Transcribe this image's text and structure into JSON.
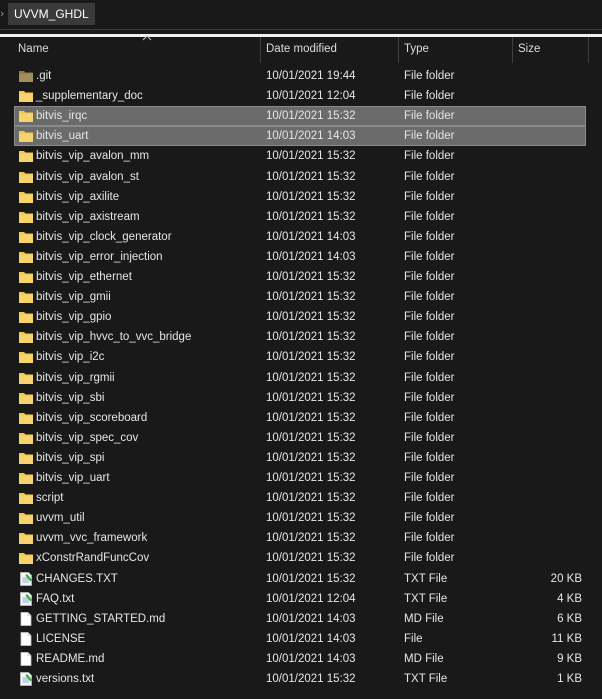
{
  "breadcrumb": {
    "items": [
      "UVVM_GHDL"
    ]
  },
  "columns": {
    "name": "Name",
    "date": "Date modified",
    "type": "Type",
    "size": "Size"
  },
  "files": [
    {
      "name": ".git",
      "date": "10/01/2021 19:44",
      "type": "File folder",
      "size": "",
      "icon": "folder-hidden-icon",
      "selected": false
    },
    {
      "name": "_supplementary_doc",
      "date": "10/01/2021 12:04",
      "type": "File folder",
      "size": "",
      "icon": "folder-icon",
      "selected": false
    },
    {
      "name": "bitvis_irqc",
      "date": "10/01/2021 15:32",
      "type": "File folder",
      "size": "",
      "icon": "folder-icon",
      "selected": true
    },
    {
      "name": "bitvis_uart",
      "date": "10/01/2021 14:03",
      "type": "File folder",
      "size": "",
      "icon": "folder-icon",
      "selected": true
    },
    {
      "name": "bitvis_vip_avalon_mm",
      "date": "10/01/2021 15:32",
      "type": "File folder",
      "size": "",
      "icon": "folder-icon",
      "selected": false
    },
    {
      "name": "bitvis_vip_avalon_st",
      "date": "10/01/2021 15:32",
      "type": "File folder",
      "size": "",
      "icon": "folder-icon",
      "selected": false
    },
    {
      "name": "bitvis_vip_axilite",
      "date": "10/01/2021 15:32",
      "type": "File folder",
      "size": "",
      "icon": "folder-icon",
      "selected": false
    },
    {
      "name": "bitvis_vip_axistream",
      "date": "10/01/2021 15:32",
      "type": "File folder",
      "size": "",
      "icon": "folder-icon",
      "selected": false
    },
    {
      "name": "bitvis_vip_clock_generator",
      "date": "10/01/2021 14:03",
      "type": "File folder",
      "size": "",
      "icon": "folder-icon",
      "selected": false
    },
    {
      "name": "bitvis_vip_error_injection",
      "date": "10/01/2021 14:03",
      "type": "File folder",
      "size": "",
      "icon": "folder-icon",
      "selected": false
    },
    {
      "name": "bitvis_vip_ethernet",
      "date": "10/01/2021 15:32",
      "type": "File folder",
      "size": "",
      "icon": "folder-icon",
      "selected": false
    },
    {
      "name": "bitvis_vip_gmii",
      "date": "10/01/2021 15:32",
      "type": "File folder",
      "size": "",
      "icon": "folder-icon",
      "selected": false
    },
    {
      "name": "bitvis_vip_gpio",
      "date": "10/01/2021 15:32",
      "type": "File folder",
      "size": "",
      "icon": "folder-icon",
      "selected": false
    },
    {
      "name": "bitvis_vip_hvvc_to_vvc_bridge",
      "date": "10/01/2021 15:32",
      "type": "File folder",
      "size": "",
      "icon": "folder-icon",
      "selected": false
    },
    {
      "name": "bitvis_vip_i2c",
      "date": "10/01/2021 15:32",
      "type": "File folder",
      "size": "",
      "icon": "folder-icon",
      "selected": false
    },
    {
      "name": "bitvis_vip_rgmii",
      "date": "10/01/2021 15:32",
      "type": "File folder",
      "size": "",
      "icon": "folder-icon",
      "selected": false
    },
    {
      "name": "bitvis_vip_sbi",
      "date": "10/01/2021 15:32",
      "type": "File folder",
      "size": "",
      "icon": "folder-icon",
      "selected": false
    },
    {
      "name": "bitvis_vip_scoreboard",
      "date": "10/01/2021 15:32",
      "type": "File folder",
      "size": "",
      "icon": "folder-icon",
      "selected": false
    },
    {
      "name": "bitvis_vip_spec_cov",
      "date": "10/01/2021 15:32",
      "type": "File folder",
      "size": "",
      "icon": "folder-icon",
      "selected": false
    },
    {
      "name": "bitvis_vip_spi",
      "date": "10/01/2021 15:32",
      "type": "File folder",
      "size": "",
      "icon": "folder-icon",
      "selected": false
    },
    {
      "name": "bitvis_vip_uart",
      "date": "10/01/2021 15:32",
      "type": "File folder",
      "size": "",
      "icon": "folder-icon",
      "selected": false
    },
    {
      "name": "script",
      "date": "10/01/2021 15:32",
      "type": "File folder",
      "size": "",
      "icon": "folder-icon",
      "selected": false
    },
    {
      "name": "uvvm_util",
      "date": "10/01/2021 15:32",
      "type": "File folder",
      "size": "",
      "icon": "folder-icon",
      "selected": false
    },
    {
      "name": "uvvm_vvc_framework",
      "date": "10/01/2021 15:32",
      "type": "File folder",
      "size": "",
      "icon": "folder-icon",
      "selected": false
    },
    {
      "name": "xConstrRandFuncCov",
      "date": "10/01/2021 15:32",
      "type": "File folder",
      "size": "",
      "icon": "folder-icon",
      "selected": false
    },
    {
      "name": "CHANGES.TXT",
      "date": "10/01/2021 15:32",
      "type": "TXT File",
      "size": "20 KB",
      "icon": "notepad-file-icon",
      "selected": false
    },
    {
      "name": "FAQ.txt",
      "date": "10/01/2021 12:04",
      "type": "TXT File",
      "size": "4 KB",
      "icon": "notepad-file-icon",
      "selected": false
    },
    {
      "name": "GETTING_STARTED.md",
      "date": "10/01/2021 14:03",
      "type": "MD File",
      "size": "6 KB",
      "icon": "blank-file-icon",
      "selected": false
    },
    {
      "name": "LICENSE",
      "date": "10/01/2021 14:03",
      "type": "File",
      "size": "11 KB",
      "icon": "blank-file-icon",
      "selected": false
    },
    {
      "name": "README.md",
      "date": "10/01/2021 14:03",
      "type": "MD File",
      "size": "9 KB",
      "icon": "blank-file-icon",
      "selected": false
    },
    {
      "name": "versions.txt",
      "date": "10/01/2021 15:32",
      "type": "TXT File",
      "size": "1 KB",
      "icon": "notepad-file-icon",
      "selected": false
    }
  ],
  "colors": {
    "background": "#191919",
    "selection": "#6b6b6b",
    "folder": "#f2c94c",
    "folder_hidden": "#8a7a4a",
    "text": "#e6e6e6"
  }
}
